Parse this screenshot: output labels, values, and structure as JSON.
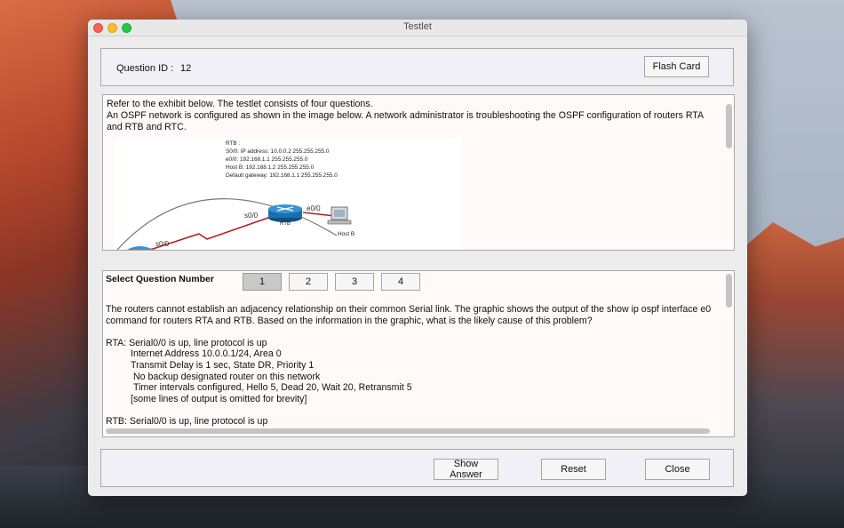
{
  "window": {
    "title": "Testlet"
  },
  "header": {
    "question_id_label": "Question ID :",
    "question_id_value": "12",
    "flash_card_label": "Flash Card"
  },
  "exhibit": {
    "lines": [
      "Refer to the exhibit below. The testlet consists of four questions.",
      "An OSPF network is configured as shown in the image below. A network administrator is troubleshooting the OSPF configuration of routers RTA and RTB and RTC."
    ],
    "diagram": {
      "rtb_info": [
        "RTB :",
        "S0/0: IP address: 10.0.0.2 255.255.255.0",
        "e0/0: 192.168.1.1 255.255.255.0",
        "Host B: 192.168.1.2 255.255.255.0",
        "Default gateway: 192.168.1.1 255.255.255.0"
      ],
      "router_label": "RTB",
      "host_label": "Host B",
      "s00_label_1": "s0/0",
      "s00_label_2": "s0/0",
      "e00_label": "e0/0"
    }
  },
  "question": {
    "select_label": "Select Question Number",
    "numbers": [
      "1",
      "2",
      "3",
      "4"
    ],
    "selected": "1",
    "body": [
      "The routers cannot establish an adjacency relationship on their common Serial link. The graphic shows the output of the show ip ospf interface e0",
      "command for routers RTA and RTB. Based on the information in the graphic, what is the likely cause of this problem?",
      "",
      "RTA: Serial0/0 is up, line protocol is up",
      "Internet Address 10.0.0.1/24, Area 0",
      "Transmit Delay is 1 sec, State DR, Priority 1",
      "No backup designated router on this network",
      "Timer intervals configured, Hello 5, Dead 20, Wait 20, Retransmit 5",
      "[some lines of output is omitted for brevity]",
      "",
      "RTB: Serial0/0 is up, line protocol is up"
    ]
  },
  "footer": {
    "show_answer_label": "Show Answer",
    "reset_label": "Reset",
    "close_label": "Close"
  },
  "colors": {
    "router": "#1a6fb0",
    "link": "#b02020",
    "title_text": "#4d4d4d"
  }
}
